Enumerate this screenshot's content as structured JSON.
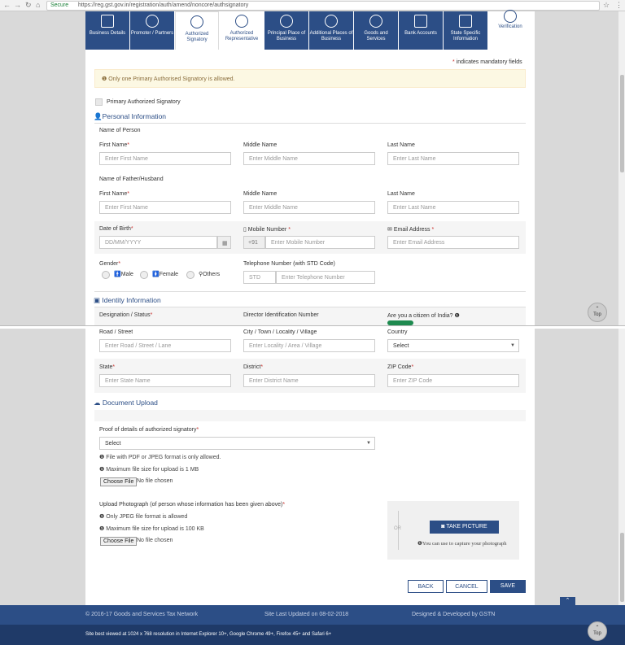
{
  "browser": {
    "secure_label": "Secure",
    "url": "https://reg.gst.gov.in/registration/auth/amend/noncore/authsignatory"
  },
  "tabs": [
    {
      "label": "Business Details"
    },
    {
      "label": "Promoter / Partners"
    },
    {
      "label": "Authorized Signatory"
    },
    {
      "label": "Authorized Representative"
    },
    {
      "label": "Principal Place of Business"
    },
    {
      "label": "Additional Places of Business"
    },
    {
      "label": "Goods and Services"
    },
    {
      "label": "Bank Accounts"
    },
    {
      "label": "State Specific Information"
    },
    {
      "label": "Verification"
    }
  ],
  "mandatory_note": "indicates mandatory fields",
  "alert_text": "Only one Primary Authorised Signatory is allowed.",
  "primary_checkbox_label": "Primary Authorized Signatory",
  "personal": {
    "title": "Personal Information",
    "name_of_person": "Name of Person",
    "first_name_label": "First Name",
    "first_name_ph": "Enter First Name",
    "middle_name_label": "Middle Name",
    "middle_name_ph": "Enter Middle Name",
    "last_name_label": "Last Name",
    "last_name_ph": "Enter Last Name",
    "father_label": "Name of Father/Husband",
    "dob_label": "Date of Birth",
    "dob_ph": "DD/MM/YYYY",
    "mobile_label": "Mobile Number",
    "mobile_prefix": "+91",
    "mobile_ph": "Enter Mobile Number",
    "email_label": "Email Address",
    "email_ph": "Enter Email Address",
    "gender_label": "Gender",
    "gender_male": "Male",
    "gender_female": "Female",
    "gender_others": "Others",
    "telephone_label": "Telephone Number (with STD Code)",
    "std_ph": "STD",
    "telephone_ph": "Enter Telephone Number"
  },
  "identity": {
    "title": "Identity Information",
    "designation_label": "Designation / Status",
    "din_label": "Director Identification Number",
    "citizen_label": "Are you a citizen of India?"
  },
  "address": {
    "road_label": "Road / Street",
    "road_ph": "Enter Road / Street / Lane",
    "city_label": "City / Town / Locality / Village",
    "city_ph": "Enter Locality / Area / Village",
    "country_label": "Country",
    "country_value": "Select",
    "state_label": "State",
    "state_ph": "Enter State Name",
    "district_label": "District",
    "district_ph": "Enter District Name",
    "zip_label": "ZIP Code",
    "zip_ph": "Enter ZIP Code"
  },
  "document": {
    "title": "Document Upload",
    "proof_label": "Proof of details of authorized signatory",
    "proof_value": "Select",
    "note1": "File with PDF or JPEG format is only allowed.",
    "note2": "Maximum file size for upload is 1 MB",
    "choose_file": "Choose File",
    "no_file": "No file chosen",
    "photo_label": "Upload Photograph (of person whose information has been given above)",
    "photo_note1": "Only JPEG file format is allowed",
    "photo_note2": "Maximum file size for upload is 100 KB",
    "or": "OR",
    "take_picture": "TAKE PICTURE",
    "capture_note": "You can use to capture your photograph"
  },
  "actions": {
    "back": "BACK",
    "cancel": "CANCEL",
    "save": "SAVE"
  },
  "footer": {
    "copyright": "© 2016-17 Goods and Services Tax Network",
    "updated": "Site Last Updated on 08-02-2018",
    "developed": "Designed & Developed by GSTN",
    "best_viewed": "Site best viewed at 1024 x 768 resolution in Internet Explorer 10+, Google Chrome 49+, Firefox 45+ and Safari 6+"
  },
  "top_button": "Top",
  "colors": {
    "primary": "#2c4e86",
    "required": "#c9302c",
    "toggle": "#1e8a4f"
  }
}
